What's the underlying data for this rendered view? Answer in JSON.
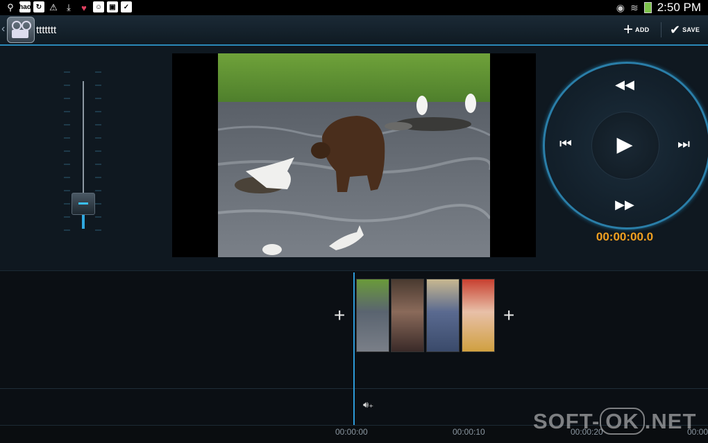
{
  "status_bar": {
    "icons": [
      "usb-icon",
      "hao123-icon",
      "sync-icon",
      "warning-icon",
      "download-icon",
      "heart-icon",
      "app-icon",
      "gallery-icon",
      "clipboard-icon"
    ],
    "hao_label": "hao",
    "time": "2:50 PM",
    "right_icons": [
      "eye-icon",
      "wifi-icon",
      "battery-icon"
    ]
  },
  "action_bar": {
    "project_title": "ttttttt",
    "add_label": "ADD",
    "save_label": "SAVE",
    "accent": "#2a89b8"
  },
  "player": {
    "timecode": "00:00:00.0",
    "timecode_color": "#f0a020",
    "buttons": [
      "rewind-icon",
      "skip-previous-icon",
      "play-icon",
      "skip-next-icon",
      "fast-forward-icon"
    ]
  },
  "volume": {
    "level": 0.15
  },
  "timeline": {
    "clips": [
      {
        "name": "bear-river-clip",
        "colors": [
          "#6a9a3a",
          "#5a6470",
          "#7a7f88"
        ]
      },
      {
        "name": "zombie-clip",
        "colors": [
          "#4a3a30",
          "#8a6a5a",
          "#3a2a28"
        ]
      },
      {
        "name": "man-office-clip",
        "colors": [
          "#c8b890",
          "#5a6a90",
          "#3a4a6a"
        ]
      },
      {
        "name": "bride-clip",
        "colors": [
          "#c84030",
          "#e8c0a8",
          "#d0a040"
        ]
      }
    ],
    "ruler": [
      "00:00:00",
      "00:00:10",
      "00:00:20",
      "00:00"
    ]
  },
  "watermark": {
    "prefix": "SOFT-",
    "ok": "OK",
    "suffix": ".NET"
  }
}
